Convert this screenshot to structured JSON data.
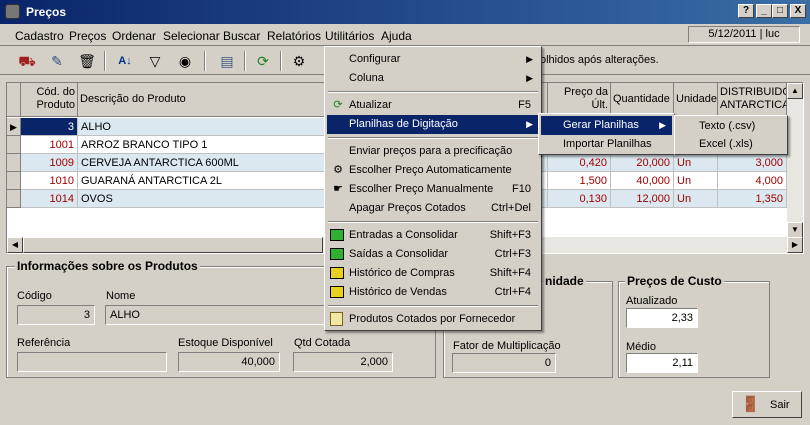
{
  "window": {
    "title": "Preços",
    "buttons": [
      "?",
      "_",
      "□",
      "X"
    ]
  },
  "menubar": {
    "items": [
      "Cadastro",
      "Preços",
      "Ordenar",
      "Selecionar",
      "Buscar",
      "Relatórios",
      "Utilitários",
      "Ajuda"
    ],
    "status": "5/12/2011 | luc"
  },
  "toolbar": {
    "info": "olhidos após alterações."
  },
  "grid": {
    "headers": [
      "Cód. do Produto",
      "Descrição do Produto",
      "Preço da Últ. Compra",
      "Quantidade",
      "Unidade",
      "DISTRIBUIDO ANTARCTICA"
    ],
    "rows": [
      {
        "code": "3",
        "desc": "ALHO",
        "price": "",
        "qty": "",
        "unit": "",
        "dist": ""
      },
      {
        "code": "1001",
        "desc": "ARROZ BRANCO TIPO 1",
        "price": "",
        "qty": "",
        "unit": "",
        "dist": ""
      },
      {
        "code": "1009",
        "desc": "CERVEJA ANTARCTICA 600ML",
        "price": "0,420",
        "qty": "20,000",
        "unit": "Un",
        "dist": "3,000"
      },
      {
        "code": "1010",
        "desc": "GUARANÁ ANTARCTICA 2L",
        "price": "1,500",
        "qty": "40,000",
        "unit": "Un",
        "dist": "4,000"
      },
      {
        "code": "1014",
        "desc": "OVOS",
        "price": "0,130",
        "qty": "12,000",
        "unit": "Un",
        "dist": "1,350"
      }
    ]
  },
  "info": {
    "title": "Informações sobre os Produtos",
    "codigo_label": "Código",
    "codigo": "3",
    "nome_label": "Nome",
    "nome": "ALHO",
    "referencia_label": "Referência",
    "referencia": "",
    "estoque_label": "Estoque Disponível",
    "estoque": "40,000",
    "qtd_label": "Qtd Cotada",
    "qtd": "2,000"
  },
  "unidade": {
    "title": "nidade",
    "fator_label": "Fator de Multiplicação",
    "fator": "0"
  },
  "custo": {
    "title": "Preços de Custo",
    "atualizado_label": "Atualizado",
    "atualizado": "2,33",
    "medio_label": "Médio",
    "medio": "2,11"
  },
  "sair": "Sair",
  "menu": {
    "items": [
      {
        "label": "Configurar",
        "sub": true
      },
      {
        "label": "Coluna",
        "sub": true
      },
      {
        "label": "Atualizar",
        "shortcut": "F5",
        "icon": "refresh-icon"
      },
      {
        "label": "Planilhas de Digitação",
        "sub": true,
        "selected": true
      },
      {
        "label": "Enviar preços para a precificação"
      },
      {
        "label": "Escolher Preço Automaticamente",
        "icon": "gear-icon"
      },
      {
        "label": "Escolher Preço Manualmente",
        "shortcut": "F10",
        "icon": "hand-icon"
      },
      {
        "label": "Apagar Preços Cotados",
        "shortcut": "Ctrl+Del"
      },
      {
        "label": "Entradas a Consolidar",
        "shortcut": "Shift+F3",
        "icon": "folder-green-icon"
      },
      {
        "label": "Saídas a Consolidar",
        "shortcut": "Ctrl+F3",
        "icon": "folder-green-icon"
      },
      {
        "label": "Histórico de Compras",
        "shortcut": "Shift+F4",
        "icon": "folder-yellow-icon"
      },
      {
        "label": "Histórico de Vendas",
        "shortcut": "Ctrl+F4",
        "icon": "folder-yellow-icon"
      },
      {
        "label": "Produtos Cotados por Fornecedor",
        "icon": "document-icon"
      }
    ]
  },
  "submenu1": {
    "items": [
      {
        "label": "Gerar Planilhas",
        "selected": true
      },
      {
        "label": "Importar Planilhas"
      }
    ]
  },
  "submenu2": {
    "items": [
      {
        "label": "Texto (.csv)"
      },
      {
        "label": "Excel (.xls)"
      }
    ]
  }
}
